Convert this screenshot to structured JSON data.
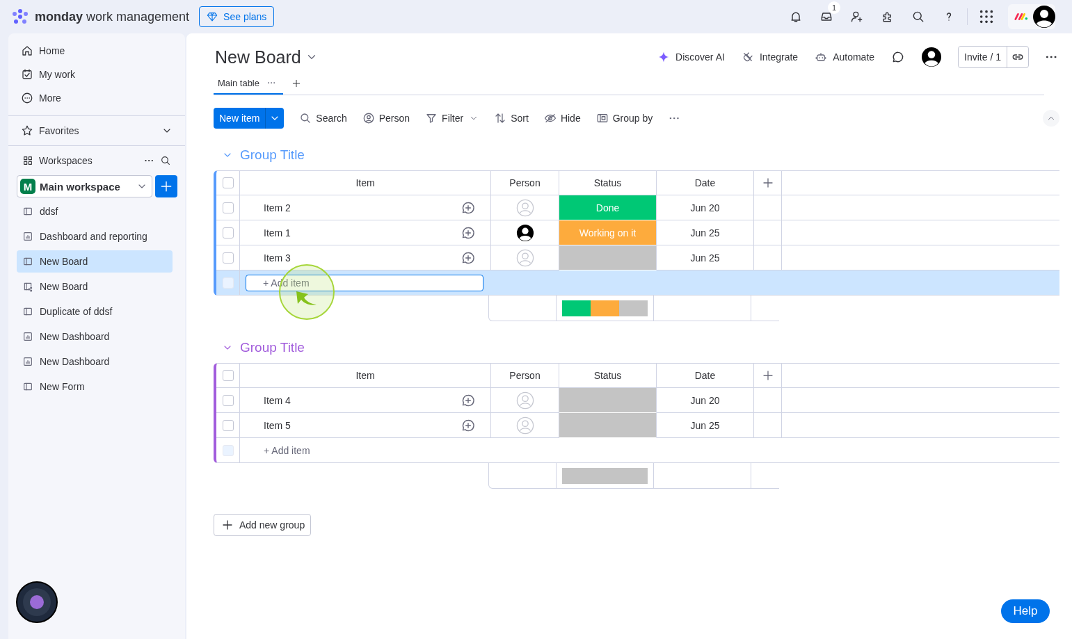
{
  "topbar": {
    "brand": "**monday** work management",
    "plans_button": "See plans",
    "inbox_count": "1"
  },
  "sidebar": {
    "nav": [
      {
        "label": "Home"
      },
      {
        "label": "My work"
      },
      {
        "label": "More"
      }
    ],
    "favorites": "Favorites",
    "workspaces": "Workspaces",
    "workspace": {
      "badge": "M",
      "name": "Main workspace"
    },
    "items": [
      {
        "label": "ddsf",
        "kind": "board",
        "selected": false
      },
      {
        "label": "Dashboard and reporting",
        "kind": "dashboard",
        "selected": false
      },
      {
        "label": "New Board",
        "kind": "board",
        "selected": true
      },
      {
        "label": "New Board",
        "kind": "shared-board",
        "selected": false
      },
      {
        "label": "Duplicate of ddsf",
        "kind": "board",
        "selected": false
      },
      {
        "label": "New Dashboard",
        "kind": "dashboard",
        "selected": false
      },
      {
        "label": "New Dashboard",
        "kind": "dashboard",
        "selected": false
      },
      {
        "label": "New Form",
        "kind": "form",
        "selected": false
      }
    ]
  },
  "board": {
    "title": "New Board",
    "actions": [
      {
        "label": "Discover AI"
      },
      {
        "label": "Integrate"
      },
      {
        "label": "Automate"
      }
    ],
    "invite": "Invite / 1",
    "views": [
      {
        "label": "Main table",
        "selected": true
      }
    ],
    "new_item": "New item",
    "tools": [
      {
        "label": "Search"
      },
      {
        "label": "Person"
      },
      {
        "label": "Filter"
      },
      {
        "label": "Sort"
      },
      {
        "label": "Hide"
      },
      {
        "label": "Group by"
      }
    ]
  },
  "groups": [
    {
      "title": "Group Title",
      "color": "#579bfc",
      "all_checked": false,
      "columns": [
        "Item",
        "Person",
        "Status",
        "Date"
      ],
      "rows": [
        {
          "checked": false,
          "item": "Item 2",
          "assigned": false,
          "status": "Done",
          "color": "#00c875",
          "date": "Jun 20"
        },
        {
          "checked": false,
          "item": "Item 1",
          "assigned": true,
          "status": "Working on it",
          "color": "#fdab3d",
          "date": "Jun 25"
        },
        {
          "checked": false,
          "item": "Item 3",
          "assigned": false,
          "color": "#c4c4c4",
          "date": "Jun 25"
        }
      ],
      "add_item": {
        "checked": false,
        "placeholder": "+ Add item",
        "focused": true
      }
    },
    {
      "title": "Group Title",
      "color": "#a25ddc",
      "all_checked": false,
      "columns": [
        "Item",
        "Person",
        "Status",
        "Date"
      ],
      "rows": [
        {
          "checked": false,
          "item": "Item 4",
          "assigned": false,
          "color": "#c4c4c4",
          "date": "Jun 20"
        },
        {
          "checked": false,
          "item": "Item 5",
          "assigned": false,
          "color": "#c4c4c4",
          "date": "Jun 25"
        }
      ],
      "add_item": {
        "checked": false,
        "placeholder": "+ Add item",
        "focused": false
      }
    }
  ],
  "add_group": "Add new group",
  "help": "Help"
}
